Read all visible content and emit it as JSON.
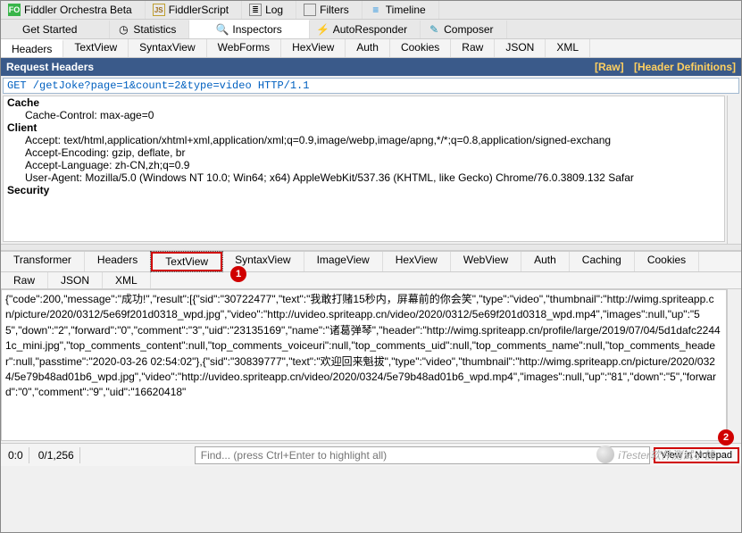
{
  "topTabs": [
    {
      "label": "Fiddler Orchestra Beta",
      "icon": "FO",
      "iconBg": "#39b54a"
    },
    {
      "label": "FiddlerScript",
      "icon": "js",
      "iconBg": "#f0c040"
    },
    {
      "label": "Log",
      "icon": "≡",
      "iconBg": ""
    },
    {
      "label": "Filters",
      "icon": "▢",
      "iconBg": ""
    },
    {
      "label": "Timeline",
      "icon": "≡",
      "iconBg": "#2090e0"
    }
  ],
  "topTabs2": [
    {
      "label": "Get Started",
      "icon": ""
    },
    {
      "label": "Statistics",
      "icon": "◷"
    },
    {
      "label": "Inspectors",
      "icon": "🔍"
    },
    {
      "label": "AutoResponder",
      "icon": "⚡"
    },
    {
      "label": "Composer",
      "icon": "✎"
    }
  ],
  "activeTopTab2": 2,
  "reqTabs": [
    "Headers",
    "TextView",
    "SyntaxView",
    "WebForms",
    "HexView",
    "Auth",
    "Cookies",
    "Raw",
    "JSON",
    "XML"
  ],
  "reqActive": 0,
  "hdrTitle": "Request Headers",
  "hdrLinks": {
    "raw": "[Raw]",
    "defs": "[Header Definitions]"
  },
  "requestLine": "GET /getJoke?page=1&count=2&type=video HTTP/1.1",
  "reqHeaders": {
    "Cache": [
      "Cache-Control: max-age=0"
    ],
    "Client": [
      "Accept: text/html,application/xhtml+xml,application/xml;q=0.9,image/webp,image/apng,*/*;q=0.8,application/signed-exchang",
      "Accept-Encoding: gzip, deflate, br",
      "Accept-Language: zh-CN,zh;q=0.9",
      "User-Agent: Mozilla/5.0 (Windows NT 10.0; Win64; x64) AppleWebKit/537.36 (KHTML, like Gecko) Chrome/76.0.3809.132 Safar"
    ],
    "Security": []
  },
  "respTabsRow1": [
    "Transformer",
    "Headers",
    "TextView",
    "SyntaxView",
    "ImageView",
    "HexView",
    "WebView",
    "Auth",
    "Caching",
    "Cookies"
  ],
  "respTabsRow2": [
    "Raw",
    "JSON",
    "XML"
  ],
  "respHighlighted": 2,
  "bodyText": "{\"code\":200,\"message\":\"成功!\",\"result\":[{\"sid\":\"30722477\",\"text\":\"我敢打赌15秒内，屏幕前的你会笑\",\"type\":\"video\",\"thumbnail\":\"http://wimg.spriteapp.cn/picture/2020/0312/5e69f201d0318_wpd.jpg\",\"video\":\"http://uvideo.spriteapp.cn/video/2020/0312/5e69f201d0318_wpd.mp4\",\"images\":null,\"up\":\"55\",\"down\":\"2\",\"forward\":\"0\",\"comment\":\"3\",\"uid\":\"23135169\",\"name\":\"诸葛弹琴\",\"header\":\"http://wimg.spriteapp.cn/profile/large/2019/07/04/5d1dafc22441c_mini.jpg\",\"top_comments_content\":null,\"top_comments_voiceuri\":null,\"top_comments_uid\":null,\"top_comments_name\":null,\"top_comments_header\":null,\"passtime\":\"2020-03-26 02:54:02\"},{\"sid\":\"30839777\",\"text\":\"欢迎回来魁拔\",\"type\":\"video\",\"thumbnail\":\"http://wimg.spriteapp.cn/picture/2020/0324/5e79b48ad01b6_wpd.jpg\",\"video\":\"http://uvideo.spriteapp.cn/video/2020/0324/5e79b48ad01b6_wpd.mp4\",\"images\":null,\"up\":\"81\",\"down\":\"5\",\"forward\":\"0\",\"comment\":\"9\",\"uid\":\"16620418\"",
  "status": {
    "pos": "0:0",
    "count": "0/1,256"
  },
  "findPlaceholder": "Find... (press Ctrl+Enter to highlight all)",
  "notepadLabel": "View in Notepad",
  "anno": {
    "one": "1",
    "two": "2"
  },
  "watermark": "iTester软件测试小栈"
}
